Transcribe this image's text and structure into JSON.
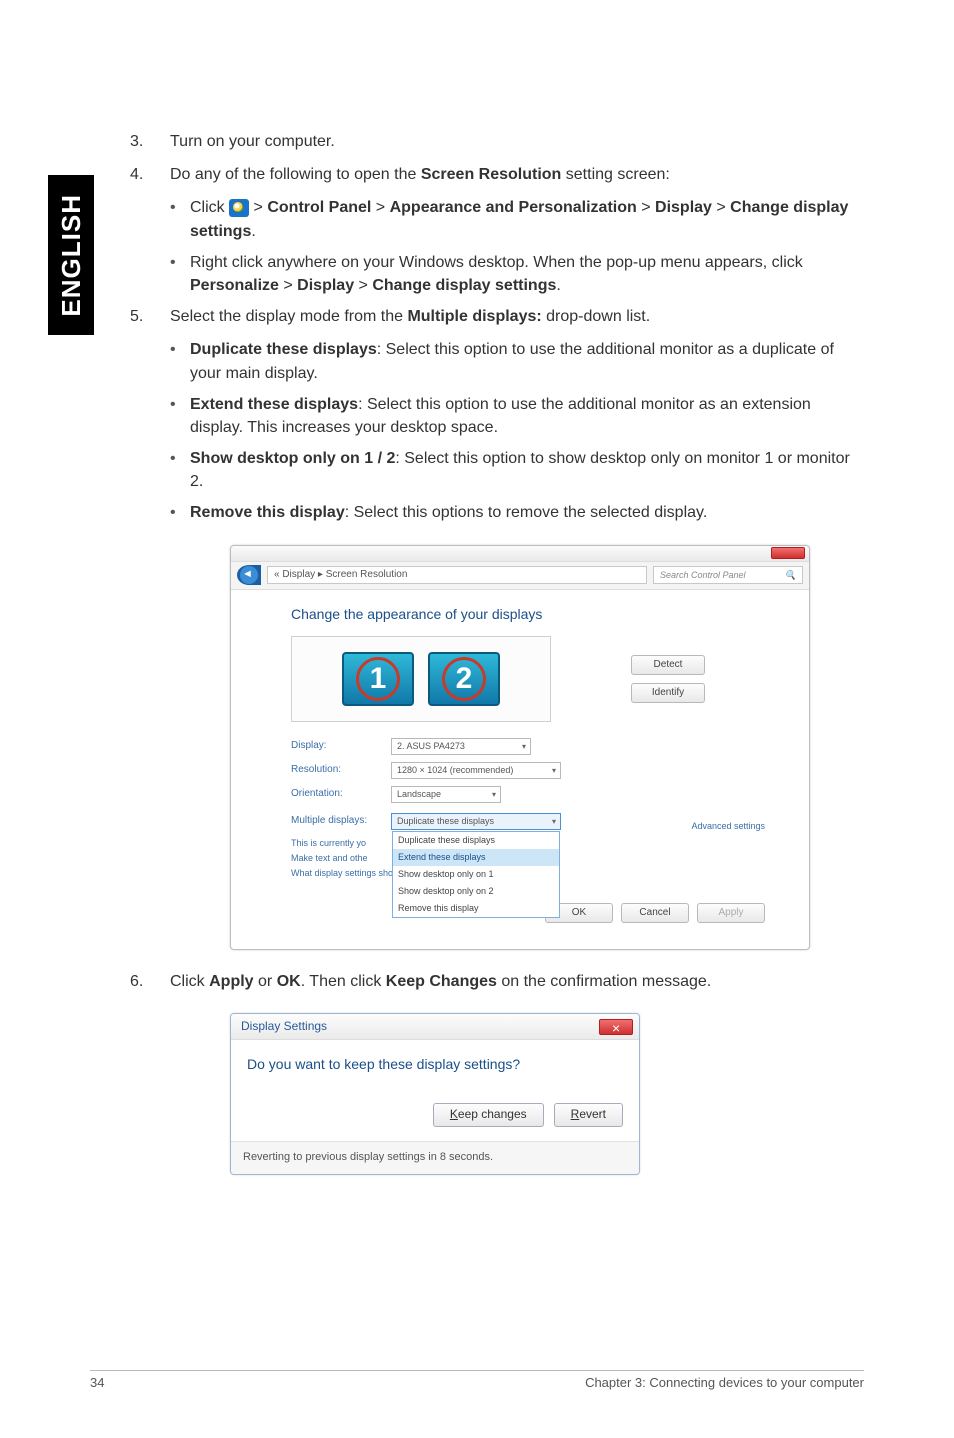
{
  "sidebar": {
    "label": "ENGLISH"
  },
  "steps": {
    "s3": {
      "num": "3.",
      "text": "Turn on your computer."
    },
    "s4": {
      "num": "4.",
      "intro_a": "Do any of the following to open the ",
      "intro_b": "Screen Resolution",
      "intro_c": " setting screen:",
      "a": {
        "click": "Click ",
        "gt1": " > ",
        "cp": "Control Panel",
        "gt2": " > ",
        "ap": "Appearance and Personalization",
        "gt3": " > ",
        "disp": "Display",
        "gt4": " > ",
        "cds": "Change display settings",
        "dot": "."
      },
      "b": {
        "t1": "Right click anywhere on your Windows desktop. When the pop-up menu appears, click ",
        "p": "Personalize",
        "gt1": " > ",
        "d": "Display",
        "gt2": " > ",
        "cds": "Change display settings",
        "dot": "."
      }
    },
    "s5": {
      "num": "5.",
      "intro_a": "Select the display mode from the ",
      "intro_b": "Multiple displays:",
      "intro_c": " drop-down list.",
      "dup_h": "Duplicate these displays",
      "dup_t": ": Select this option to use the additional monitor as a duplicate of your main display.",
      "ext_h": "Extend these displays",
      "ext_t": ": Select this option to use the additional monitor as an extension display. This increases your desktop space.",
      "show_h": "Show desktop only on 1 / 2",
      "show_t": ": Select this option to show desktop only on monitor 1 or monitor 2.",
      "rem_h": "Remove this display",
      "rem_t": ": Select this options to remove the selected display."
    },
    "s6": {
      "num": "6.",
      "a": "Click ",
      "apply": "Apply",
      "or": " or ",
      "ok": "OK",
      "b": ". Then click ",
      "keep": "Keep Changes",
      "c": " on the confirmation message."
    }
  },
  "win": {
    "breadcrumb": "« Display ▸ Screen Resolution",
    "search_ph": "Search Control Panel",
    "search_icon": "🔍",
    "heading": "Change the appearance of your displays",
    "mon1": "1",
    "mon2": "2",
    "btn_detect": "Detect",
    "btn_identify": "Identify",
    "lbl_display": "Display:",
    "val_display": "2. ASUS PA4273",
    "lbl_res": "Resolution:",
    "val_res": "1280 × 1024 (recommended)",
    "lbl_orient": "Orientation:",
    "val_orient": "Landscape",
    "lbl_multi": "Multiple displays:",
    "val_multi": "Duplicate these displays",
    "dd": {
      "a": "Duplicate these displays",
      "b": "Extend these displays",
      "c": "Show desktop only on 1",
      "d": "Show desktop only on 2",
      "e": "Remove this display"
    },
    "hint1": "This is currently yo",
    "hint2": "Make text and othe",
    "hint3": "What display settings should I choose?",
    "adv": "Advanced settings",
    "ok": "OK",
    "cancel": "Cancel",
    "apply": "Apply"
  },
  "dlg": {
    "title": "Display Settings",
    "msg": "Do you want to keep these display settings?",
    "keep_u": "K",
    "keep_rest": "eep changes",
    "revert_u": "R",
    "revert_rest": "evert",
    "footer": "Reverting to previous display settings in 8 seconds."
  },
  "footer": {
    "page": "34",
    "chapter": "Chapter 3: Connecting devices to your computer"
  }
}
